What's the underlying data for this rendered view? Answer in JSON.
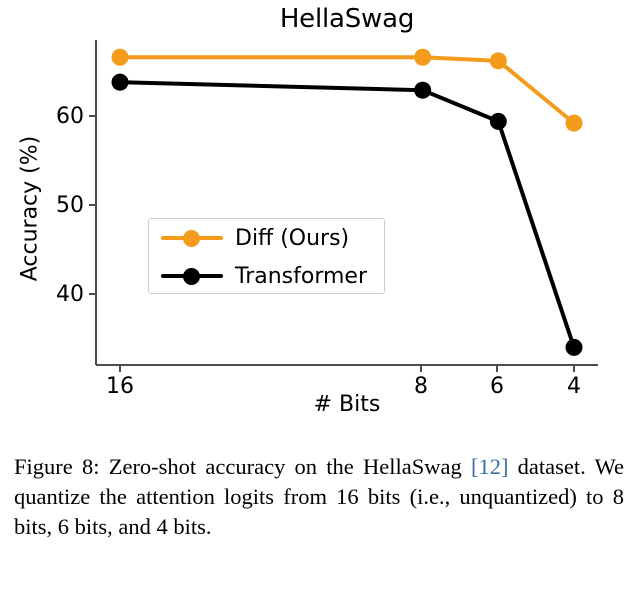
{
  "figure": {
    "title": "HellaSwag",
    "xlabel": "# Bits",
    "ylabel": "Accuracy (%)",
    "colors": {
      "diff": "#f49b1b",
      "transformer": "#000000",
      "axis": "#4d4d4d",
      "legend_border": "#cccccc",
      "citation": "#3a6ea5"
    },
    "legend": {
      "diff_label": "Diff (Ours)",
      "transformer_label": "Transformer"
    },
    "xticks": [
      "16",
      "8",
      "6",
      "4"
    ],
    "yticks": [
      "60",
      "50",
      "40"
    ]
  },
  "chart_data": {
    "type": "line",
    "title": "HellaSwag",
    "xlabel": "# Bits",
    "ylabel": "Accuracy (%)",
    "x": [
      16,
      8,
      6,
      4
    ],
    "xtick_labels": [
      "16",
      "8",
      "6",
      "4"
    ],
    "xlim": [
      17.5,
      3.0
    ],
    "ylim": [
      31.0,
      68.5
    ],
    "ytick_values": [
      60,
      50,
      40
    ],
    "ytick_labels": [
      "60",
      "50",
      "40"
    ],
    "grid": false,
    "legend_position": "center-left",
    "series": [
      {
        "name": "Diff (Ours)",
        "color": "#f49b1b",
        "marker": "o",
        "values": [
          66.6,
          66.6,
          66.2,
          59.2
        ]
      },
      {
        "name": "Transformer",
        "color": "#000000",
        "marker": "o",
        "values": [
          63.8,
          62.9,
          59.4,
          34.0
        ]
      }
    ]
  },
  "caption": {
    "prefix": "Figure 8:",
    "part1": " Zero-shot accuracy on the HellaSwag ",
    "citation": "[12]",
    "part2": " dataset. We quantize the attention logits from 16 bits (i.e., unquantized) to 8 bits, 6 bits, and 4 bits."
  }
}
